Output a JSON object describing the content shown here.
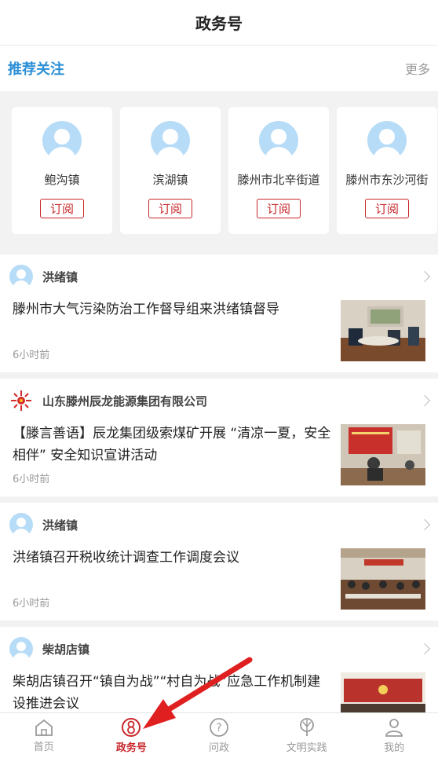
{
  "header": {
    "title": "政务号"
  },
  "recommend": {
    "title": "推荐关注",
    "more": "更多",
    "cards": [
      {
        "name": "鲍沟镇",
        "button": "订阅"
      },
      {
        "name": "滨湖镇",
        "button": "订阅"
      },
      {
        "name": "滕州市北辛街道",
        "button": "订阅"
      },
      {
        "name": "滕州市东沙河街",
        "button": "订阅"
      }
    ]
  },
  "feed": [
    {
      "source": "洪绪镇",
      "headline": "滕州市大气污染防治工作督导组来洪绪镇督导",
      "time": "6小时前"
    },
    {
      "source": "山东滕州辰龙能源集团有限公司",
      "headline": "【滕言善语】辰龙集团级索煤矿开展 “清凉一夏，安全相伴” 安全知识宣讲活动",
      "time": "6小时前"
    },
    {
      "source": "洪绪镇",
      "headline": "洪绪镇召开税收统计调查工作调度会议",
      "time": "6小时前"
    },
    {
      "source": "柴胡店镇",
      "headline": "柴胡店镇召开“镇自为战”“村自为战”应急工作机制建设推进会议",
      "time": ""
    }
  ],
  "tabbar": [
    {
      "label": "首页",
      "icon": "home-icon"
    },
    {
      "label": "政务号",
      "icon": "gov-account-icon"
    },
    {
      "label": "问政",
      "icon": "question-icon"
    },
    {
      "label": "文明实践",
      "icon": "civilization-icon"
    },
    {
      "label": "我的",
      "icon": "user-icon"
    }
  ],
  "colors": {
    "accent": "#c8262a",
    "blue": "#2b8fd6"
  }
}
